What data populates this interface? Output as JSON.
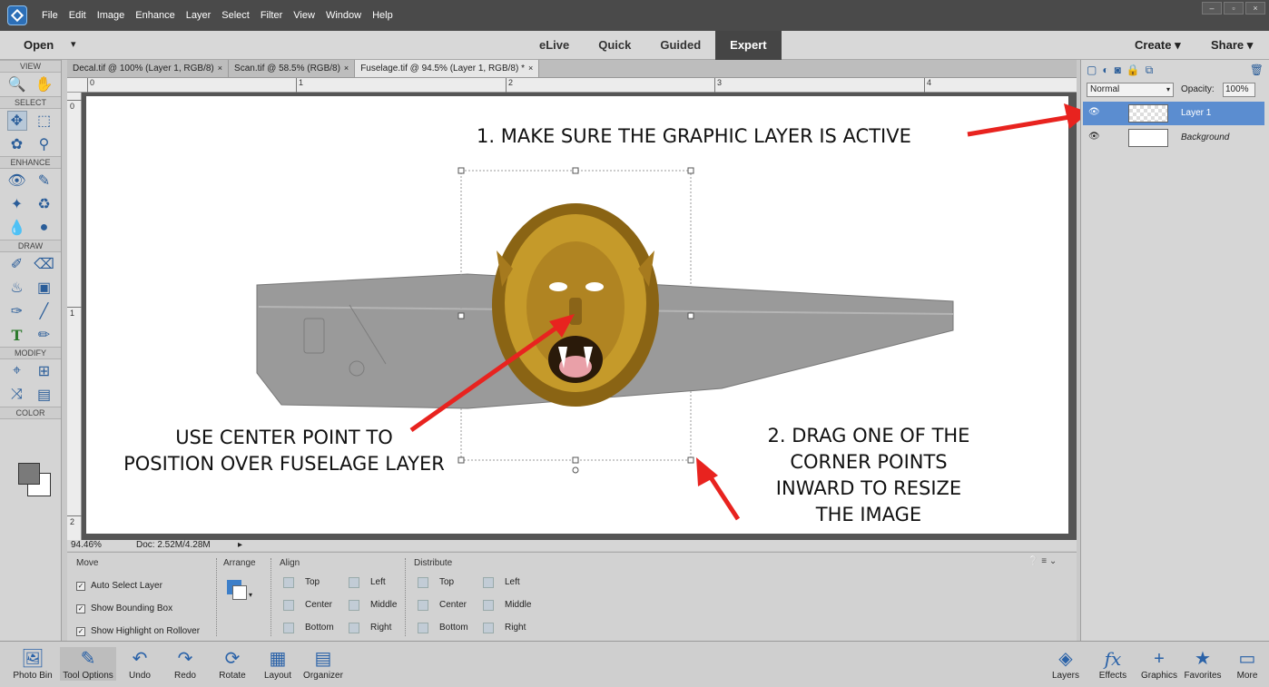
{
  "menubar": {
    "items": [
      "File",
      "Edit",
      "Image",
      "Enhance",
      "Layer",
      "Select",
      "Filter",
      "View",
      "Window",
      "Help"
    ]
  },
  "modebar": {
    "open_label": "Open",
    "modes": [
      "eLive",
      "Quick",
      "Guided",
      "Expert"
    ],
    "active_mode": "Expert",
    "create_label": "Create",
    "share_label": "Share"
  },
  "toolpanel": {
    "sections": [
      "VIEW",
      "SELECT",
      "ENHANCE",
      "DRAW",
      "MODIFY",
      "COLOR"
    ]
  },
  "tabs": [
    {
      "label": "Decal.tif @ 100% (Layer 1, RGB/8)",
      "close": "×"
    },
    {
      "label": "Scan.tif @ 58.5% (RGB/8)",
      "close": "×"
    },
    {
      "label": "Fuselage.tif @ 94.5% (Layer 1, RGB/8) *",
      "close": "×"
    }
  ],
  "ruler": {
    "h_labels": [
      "0",
      "1",
      "2",
      "3",
      "4"
    ],
    "v_labels": [
      "0",
      "1",
      "2"
    ]
  },
  "annotations": {
    "step1": "1. MAKE SURE THE GRAPHIC LAYER IS ACTIVE",
    "center_line1": "USE CENTER POINT TO",
    "center_line2": "POSITION OVER FUSELAGE LAYER",
    "step2_line1": "2. DRAG ONE OF THE",
    "step2_line2": "CORNER POINTS",
    "step2_line3": "INWARD TO RESIZE",
    "step2_line4": "THE IMAGE"
  },
  "statusbar": {
    "zoom": "94.46%",
    "doc": "Doc: 2.52M/4.28M"
  },
  "tool_options": {
    "move_label": "Move",
    "arrange_label": "Arrange",
    "align_label": "Align",
    "distribute_label": "Distribute",
    "checks": [
      "Auto Select Layer",
      "Show Bounding Box",
      "Show Highlight on Rollover"
    ],
    "align": [
      "Top",
      "Center",
      "Bottom",
      "Left",
      "Middle",
      "Right"
    ],
    "distribute": [
      "Top",
      "Center",
      "Bottom",
      "Left",
      "Middle",
      "Right"
    ]
  },
  "layers_panel": {
    "blend_mode": "Normal",
    "opacity_label": "Opacity:",
    "opacity_value": "100%",
    "layers": [
      {
        "name": "Layer 1",
        "active": true
      },
      {
        "name": "Background",
        "active": false
      }
    ]
  },
  "taskbar": {
    "left": [
      "Photo Bin",
      "Tool Options",
      "Undo",
      "Redo",
      "Rotate",
      "Layout",
      "Organizer"
    ],
    "right": [
      "Layers",
      "Effects",
      "Graphics",
      "Favorites",
      "More"
    ]
  },
  "colors": {
    "accent_blue": "#5b8dd0",
    "arrow_red": "#e8231f",
    "menubar_bg": "#4a4a4a"
  }
}
